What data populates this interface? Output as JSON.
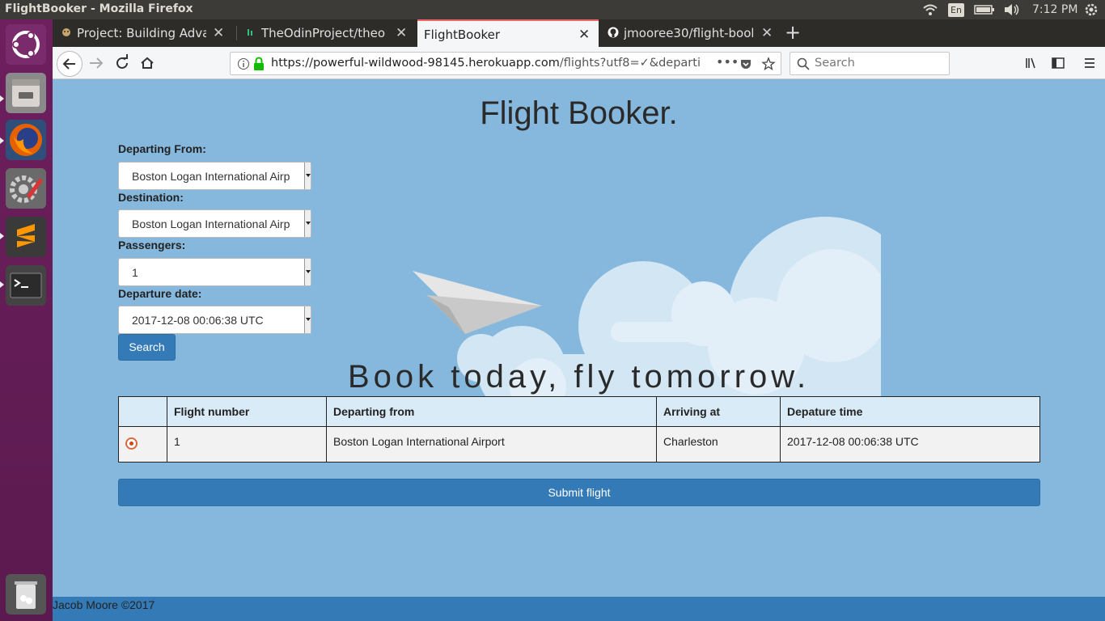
{
  "window": {
    "title": "FlightBooker - Mozilla Firefox"
  },
  "tray": {
    "lang": "En",
    "time": "7:12 PM"
  },
  "tabs": [
    {
      "label": "Project: Building Advanc",
      "active": false
    },
    {
      "label": "TheOdinProject/theo",
      "active": false
    },
    {
      "label": "FlightBooker",
      "active": true
    },
    {
      "label": "jmooree30/flight-booke",
      "active": false
    }
  ],
  "urlbar": {
    "host": "https://powerful-wildwood-98145.herokuapp.com",
    "path": "/flights?utf8=✓&departi"
  },
  "searchbar": {
    "placeholder": "Search"
  },
  "page": {
    "title": "Flight Booker.",
    "form": {
      "departing_label": "Departing From:",
      "departing_value": "Boston Logan International Airp",
      "destination_label": "Destination:",
      "destination_value": "Boston Logan International Airp",
      "passengers_label": "Passengers:",
      "passengers_value": "1",
      "date_label": "Departure date:",
      "date_value": "2017-12-08 00:06:38 UTC",
      "search_label": "Search"
    },
    "tagline": "Book today, fly tomorrow.",
    "table": {
      "headers": [
        "",
        "Flight number",
        "Departing from",
        "Arriving at",
        "Depature time"
      ],
      "rows": [
        {
          "selected": true,
          "flight_number": "1",
          "departing_from": "Boston Logan International Airport",
          "arriving_at": "Charleston",
          "departure_time": "2017-12-08 00:06:38 UTC"
        }
      ]
    },
    "submit_label": "Submit flight",
    "footer": "Jacob Moore ©2017"
  },
  "colors": {
    "page_bg": "#86b8de",
    "primary": "#337ab7",
    "launcher": "#6e1f5e"
  }
}
